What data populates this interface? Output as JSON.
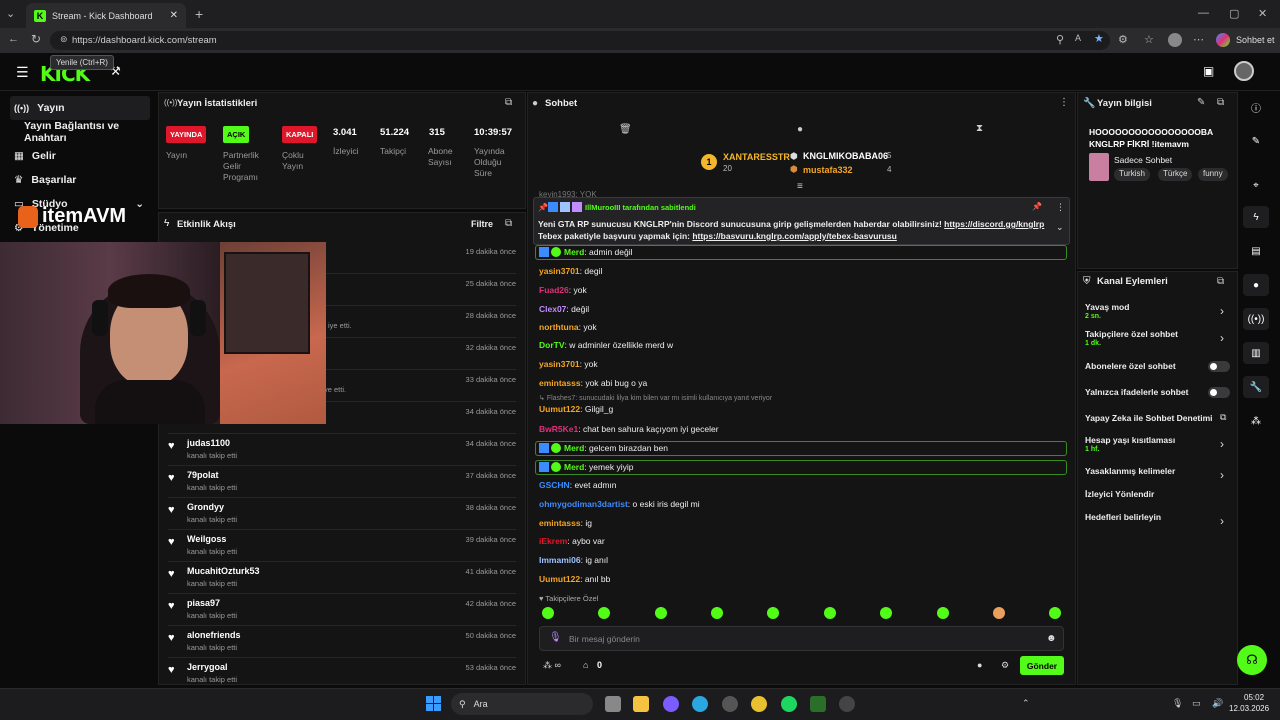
{
  "browser": {
    "tab_title": "Stream - Kick Dashboard",
    "url": "https://dashboard.kick.com/stream",
    "tooltip": "Yenile (Ctrl+R)",
    "profile_label": "Sohbet et"
  },
  "brand": {
    "logo": "KICK",
    "accent": "#53fc18"
  },
  "nav": {
    "items": [
      {
        "label": "Yayın",
        "icon": "broadcast-icon"
      },
      {
        "label": "Yayın Bağlantısı ve Anahtarı",
        "icon": ""
      },
      {
        "label": "Gelir",
        "icon": "money-icon"
      },
      {
        "label": "Başarılar",
        "icon": "trophy-icon"
      },
      {
        "label": "Stüdyo",
        "icon": "studio-icon"
      },
      {
        "label": "Yönetime",
        "icon": "manage-icon"
      }
    ]
  },
  "overlay": {
    "brand_text": "itemAVM"
  },
  "stats": {
    "title": "Yayın İstatistikleri",
    "badges": [
      {
        "text": "YAYINDA",
        "label": "Yayın",
        "color": "#e0172b"
      },
      {
        "text": "AÇIK",
        "label": "Partnerlik Gelir Programı",
        "color": "#53fc18"
      },
      {
        "text": "KAPALI",
        "label": "Çoklu Yayın",
        "color": "#e0172b"
      }
    ],
    "values": [
      {
        "value": "3.041",
        "label": "İzleyici"
      },
      {
        "value": "51.224",
        "label": "Takipçi"
      },
      {
        "value": "315",
        "label": "Abone Sayısı"
      },
      {
        "value": "10:39:57",
        "label": "Yayında Olduğu Süre"
      }
    ]
  },
  "activity": {
    "title": "Etkinlik Akışı",
    "filter": "Filtre",
    "hidden_times": [
      "19 dakika önce",
      "25 dakika önce",
      "28 dakika önce",
      "32 dakika önce",
      "33 dakika önce",
      "34 dakika önce"
    ],
    "hidden_subs": [
      "iye etti.",
      "ediye etti."
    ],
    "items": [
      {
        "name": "judas1100",
        "sub": "kanalı takip etti",
        "time": "34 dakika önce"
      },
      {
        "name": "79polat",
        "sub": "kanalı takip etti",
        "time": "37 dakika önce"
      },
      {
        "name": "Grondyy",
        "sub": "kanalı takip etti",
        "time": "38 dakika önce"
      },
      {
        "name": "Weilgoss",
        "sub": "kanalı takip etti",
        "time": "39 dakika önce"
      },
      {
        "name": "MucahitOzturk53",
        "sub": "kanalı takip etti",
        "time": "41 dakika önce"
      },
      {
        "name": "piasa97",
        "sub": "kanalı takip etti",
        "time": "42 dakika önce"
      },
      {
        "name": "alonefriends",
        "sub": "kanalı takip etti",
        "time": "50 dakika önce"
      },
      {
        "name": "Jerrygoal",
        "sub": "kanalı takip etti",
        "time": "53 dakika önce"
      }
    ]
  },
  "chat": {
    "title": "Sohbet",
    "leaderboard": {
      "first": {
        "rank": "1",
        "name": "XANTARESSTR",
        "count": "20"
      },
      "second": {
        "name": "KNGLMIKOBABA06",
        "count": "5"
      },
      "third": {
        "name": "mustafa332",
        "count": "4"
      }
    },
    "pinned": {
      "pinned_by": "IllMurooIII tarafından sabitlendi",
      "text": "Yeni GTA RP sunucusu KNGLRP'nin Discord sunucusuna girip gelişmelerden haberdar olabilirsiniz! ",
      "link1": "https://discord.gg/knglrp",
      "text2": "Tebex paketiyle başvuru yapmak için: ",
      "link2": "https://basvuru.knglrp.com/apply/tebex-basvurusu"
    },
    "messages": [
      {
        "user": "Merd",
        "text": "admin değil",
        "color": "#53fc18",
        "mod": true
      },
      {
        "user": "yasin3701",
        "text": "degil",
        "color": "#f5a623"
      },
      {
        "user": "Fuad26",
        "text": "yok",
        "color": "#e0307a"
      },
      {
        "user": "Clex07",
        "text": "değil",
        "color": "#c18cff"
      },
      {
        "user": "northtuna",
        "text": "yok",
        "color": "#f5a623"
      },
      {
        "user": "DorTV",
        "text": "w adminler özellikle merd w",
        "color": "#53fc18"
      },
      {
        "user": "yasin3701",
        "text": "yok",
        "color": "#f5a623"
      },
      {
        "user": "emintasss",
        "text": "yok abi bug o ya",
        "color": "#f5a623"
      },
      {
        "user": "Uumut122",
        "text": "Gilgil_g",
        "color": "#f5a623",
        "reply": "Flashes7: sunucudaki lilya kim bilen var mı isimli kullanıcıya yanıt veriyor"
      },
      {
        "user": "BwR5Ke1",
        "text": "chat ben sahura kaçıyom iyi geceler",
        "color": "#e0307a"
      },
      {
        "user": "Merd",
        "text": "gelcem birazdan ben",
        "color": "#53fc18",
        "mod": true
      },
      {
        "user": "Merd",
        "text": "yemek yiyip",
        "color": "#53fc18",
        "mod": true
      },
      {
        "user": "GSCHN",
        "text": "evet admın",
        "color": "#3b8cff"
      },
      {
        "user": "ohmygodiman3dartist",
        "text": "o eski iris degil mi",
        "color": "#3b8cff"
      },
      {
        "user": "emintasss",
        "text": "ig",
        "color": "#f5a623"
      },
      {
        "user": "iEkrem",
        "text": "aybo var",
        "color": "#e0172b"
      },
      {
        "user": "Immami06",
        "text": "ig anıl",
        "color": "#9ec3ff"
      },
      {
        "user": "Uumut122",
        "text": "anıl bb",
        "color": "#f5a623"
      }
    ],
    "scrolled_line": "keyin1993: YOK",
    "followers_only": "Takipçilere Özel",
    "input_placeholder": "Bir mesaj gönderin",
    "points": "0",
    "send": "Gönder"
  },
  "info": {
    "title": "Yayın bilgisi",
    "stream_title": "HOOOOOOOOOOOOOOOOBA KNGLRP FİKRİ !itemavm",
    "category": "Sadece Sohbet",
    "tags": [
      "Turkish",
      "Türkçe",
      "funny"
    ]
  },
  "actions": {
    "title": "Kanal Eylemleri",
    "items": [
      {
        "label": "Yavaş mod",
        "sub": "2 sn.",
        "control": "chevron"
      },
      {
        "label": "Takipçilere özel sohbet",
        "sub": "1 dk.",
        "control": "chevron"
      },
      {
        "label": "Abonelere özel sohbet",
        "sub": "",
        "control": "toggle"
      },
      {
        "label": "Yalnızca ifadelerle sohbet",
        "sub": "",
        "control": "toggle"
      },
      {
        "label": "Yapay Zeka ile Sohbet Denetimi",
        "sub": "",
        "control": "external"
      },
      {
        "label": "Hesap yaşı kısıtlaması",
        "sub": "1 hf.",
        "control": "chevron"
      },
      {
        "label": "Yasaklanmış kelimeler",
        "sub": "",
        "control": "chevron"
      },
      {
        "label": "İzleyici Yönlendir",
        "sub": "",
        "control": "none"
      },
      {
        "label": "Hedefleri belirleyin",
        "sub": "",
        "control": "chevron"
      }
    ]
  },
  "taskbar": {
    "search": "Ara",
    "time": "05:02",
    "date": "12.03.2026"
  }
}
